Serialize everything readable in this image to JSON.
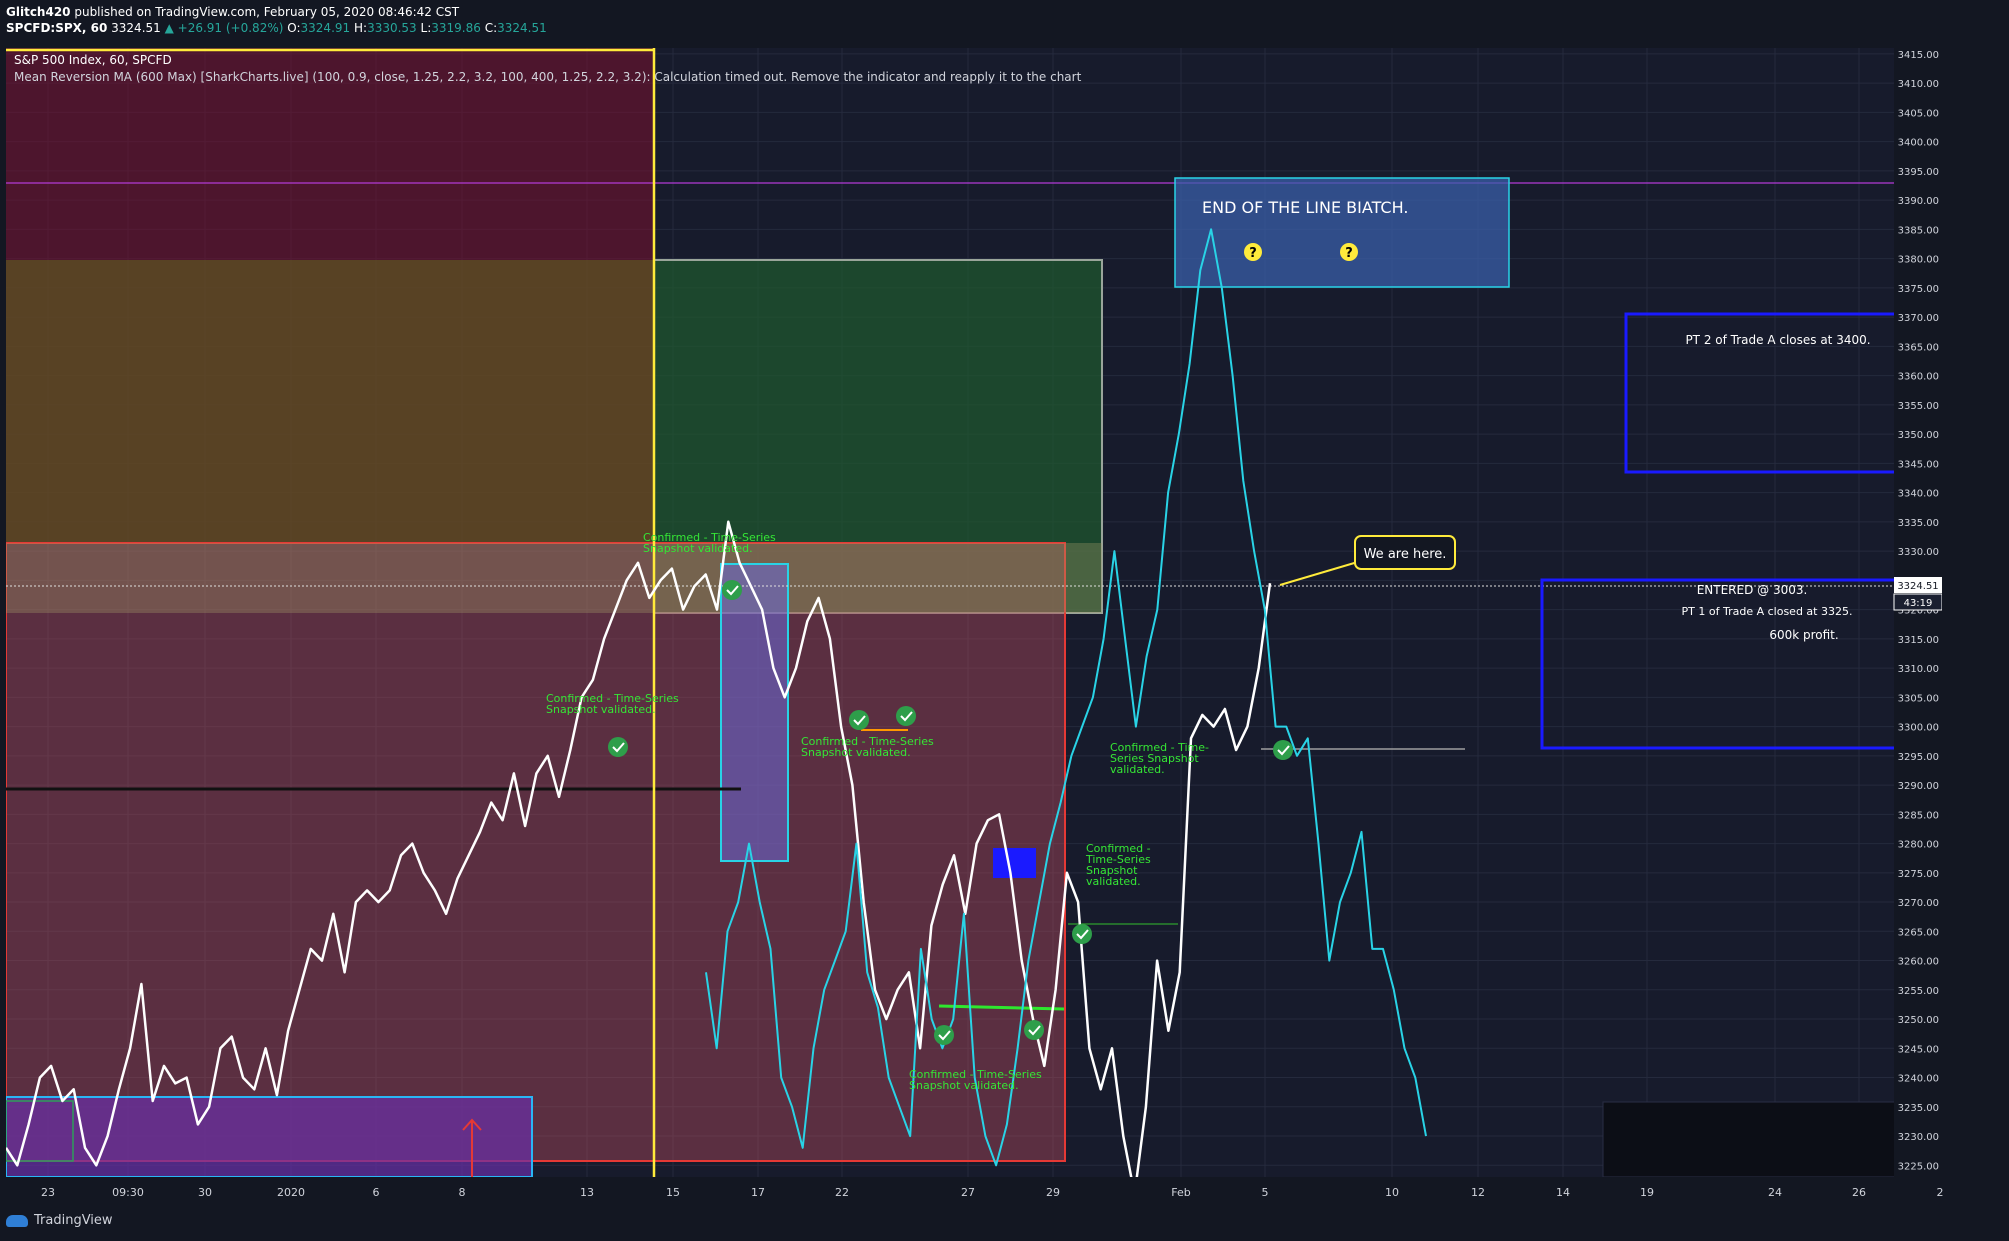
{
  "header": {
    "user": "Glitch420",
    "published": " published on TradingView.com, February 05, 2020 08:46:42 CST",
    "symbol": "SPCFD:SPX, 60",
    "last": "3324.51",
    "change": "▲ +26.91 (+0.82%)",
    "o_label": "O:",
    "o": "3324.91",
    "h_label": "H:",
    "h": "3330.53",
    "l_label": "L:",
    "l": "3319.86",
    "c_label": "C:",
    "c": "3324.51"
  },
  "legend": {
    "series": "S&P 500 Index, 60, SPCFD",
    "indicator": "Mean Reversion MA (600 Max) [SharkCharts.live] (100, 0.9, close, 1.25, 2.2, 3.2, 100, 400, 1.25, 2.2, 3.2): Calculation timed out. Remove the indicator and reapply it to the chart"
  },
  "price_tag": {
    "value": "3324.51",
    "countdown": "43:19"
  },
  "annotations": {
    "end_line": "END OF THE LINE BIATCH.",
    "question": "?",
    "we_are_here": "We are here.",
    "pt2": "PT 2 of Trade A closes at 3400.",
    "entered": "ENTERED @ 3003.",
    "pt1": "PT 1 of Trade A closed at 3325.",
    "profit": "600k profit.",
    "confirmed_1a": "Confirmed - Time-Series",
    "confirmed_1b": "Snapshot validated.",
    "confirmed_2a": "Confirmed - Time-Series",
    "confirmed_2b": "Snapshot validated.",
    "confirmed_3a": "Confirmed - Time-Series",
    "confirmed_3b": "Snapshot validated.",
    "confirmed_4a": "Confirmed - Time-",
    "confirmed_4b": "Series Snapshot",
    "confirmed_4c": "validated.",
    "confirmed_5a": "Confirmed -",
    "confirmed_5b": "Time-Series",
    "confirmed_5c": "Snapshot",
    "confirmed_5d": "validated.",
    "confirmed_6a": "Confirmed - Time-Series",
    "confirmed_6b": "Snapshot validated."
  },
  "footer": {
    "brand": "TradingView"
  },
  "colors": {
    "background": "#171b2c",
    "price_line": "#ffffff",
    "projection_line": "#29d3e6",
    "confirm_text": "#35e635",
    "accent_yellow": "#ffeb3b",
    "box_blue": "#1a1aff"
  },
  "chart_data": {
    "type": "line",
    "title": "S&P 500 Index, 60, SPCFD",
    "yticks": [
      "3225.00",
      "3230.00",
      "3235.00",
      "3240.00",
      "3245.00",
      "3250.00",
      "3255.00",
      "3260.00",
      "3265.00",
      "3270.00",
      "3275.00",
      "3280.00",
      "3285.00",
      "3290.00",
      "3295.00",
      "3300.00",
      "3305.00",
      "3310.00",
      "3315.00",
      "3320.00",
      "3325.00",
      "3330.00",
      "3335.00",
      "3340.00",
      "3345.00",
      "3350.00",
      "3355.00",
      "3360.00",
      "3365.00",
      "3370.00",
      "3375.00",
      "3380.00",
      "3385.00",
      "3390.00",
      "3395.00",
      "3400.00",
      "3405.00",
      "3410.00",
      "3415.00"
    ],
    "xticks": [
      "23",
      "09:30",
      "30",
      "2020",
      "6",
      "8",
      "13",
      "15",
      "17",
      "22",
      "27",
      "29",
      "Feb",
      "5",
      "10",
      "12",
      "14",
      "19",
      "24",
      "26",
      "2"
    ],
    "ylim": [
      3223,
      3416
    ],
    "grid": true,
    "series": [
      {
        "values": [
          3228,
          3225,
          3232,
          3240,
          3242,
          3236,
          3238,
          3228,
          3225,
          3230,
          3238,
          3245,
          3256,
          3236,
          3242,
          3239,
          3240,
          3232,
          3235,
          3245,
          3247,
          3240,
          3238,
          3245,
          3237,
          3248,
          3255,
          3262,
          3260,
          3268,
          3258,
          3270,
          3272,
          3270,
          3272,
          3278,
          3280,
          3275,
          3272,
          3268,
          3274,
          3278,
          3282,
          3287,
          3284,
          3292,
          3283,
          3292,
          3295,
          3288,
          3296,
          3305,
          3308,
          3315,
          3320,
          3325,
          3328,
          3322,
          3325,
          3327,
          3320,
          3324,
          3326,
          3320,
          3335,
          3328,
          3324,
          3320,
          3310,
          3305,
          3310,
          3318,
          3322,
          3315,
          3300,
          3290,
          3270,
          3255,
          3250,
          3255,
          3258,
          3245,
          3266,
          3273,
          3278,
          3268,
          3280,
          3284,
          3285,
          3275,
          3260,
          3250,
          3242,
          3255,
          3275,
          3270,
          3245,
          3238,
          3245,
          3230,
          3220,
          3235,
          3260,
          3248,
          3258,
          3298,
          3302,
          3300,
          3303,
          3296,
          3300,
          3310,
          3324.51
        ]
      },
      {
        "values": [
          3258,
          3245,
          3265,
          3270,
          3280,
          3270,
          3262,
          3240,
          3235,
          3228,
          3245,
          3255,
          3260,
          3265,
          3280,
          3258,
          3252,
          3240,
          3235,
          3230,
          3262,
          3250,
          3245,
          3250,
          3268,
          3240,
          3230,
          3225,
          3232,
          3245,
          3260,
          3270,
          3280,
          3287,
          3295,
          3300,
          3305,
          3315,
          3330,
          3315,
          3300,
          3312,
          3320,
          3340,
          3350,
          3362,
          3378,
          3385,
          3375,
          3360,
          3342,
          3330,
          3320,
          3300,
          3300,
          3295,
          3298,
          3280,
          3260,
          3270,
          3275,
          3282,
          3262,
          3262,
          3255,
          3245,
          3240,
          3230
        ]
      }
    ]
  }
}
